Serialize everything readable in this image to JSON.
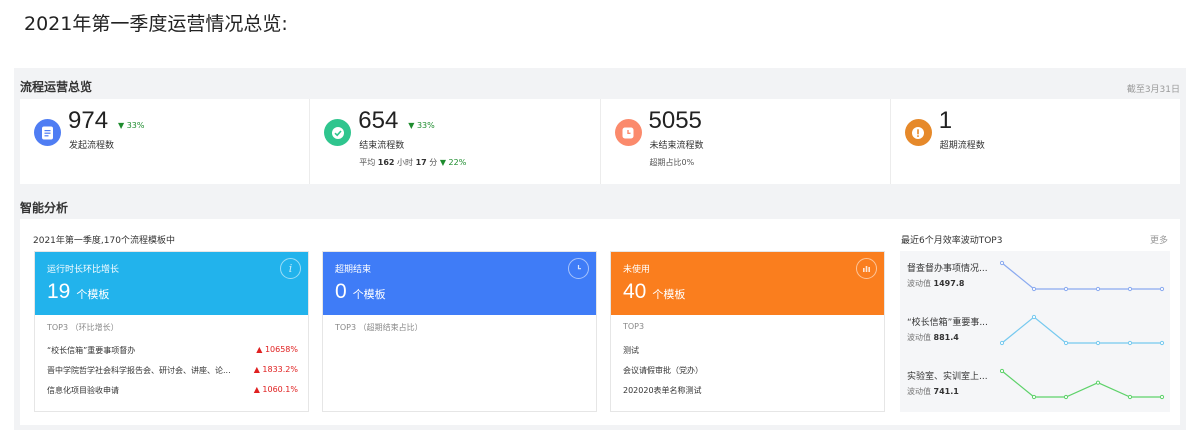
{
  "page_title": "2021年第一季度运营情况总览:",
  "overview": {
    "title": "流程运营总览",
    "date_note": "截至3月31日",
    "stats": [
      {
        "value": "974",
        "change": "▼ 33%",
        "label": "发起流程数",
        "color": "#4f7df3"
      },
      {
        "value": "654",
        "change": "▼ 33%",
        "label": "结束流程数",
        "sub": {
          "prefix": "平均",
          "hours": "162",
          "h_unit": "小时",
          "minutes": "17",
          "m_unit": "分",
          "change": "▼ 22%"
        },
        "color": "#2fc58e"
      },
      {
        "value": "5055",
        "label": "未结束流程数",
        "sub_text": "超期占比0%",
        "color": "#fb8a6c"
      },
      {
        "value": "1",
        "label": "超期流程数",
        "color": "#e6892a"
      }
    ]
  },
  "analysis": {
    "title": "智能分析",
    "subtitle": "2021年第一季度,170个流程模板中",
    "cards": [
      {
        "title": "运行时长环比增长",
        "value": "19",
        "unit": "个模板",
        "caption": "TOP3 （环比增长）",
        "rows": [
          {
            "name": "“校长信箱”重要事项督办",
            "pct": "▲ 10658%"
          },
          {
            "name": "晋中学院哲学社会科学报告会、研讨会、讲座、论...",
            "pct": "▲ 1833.2%"
          },
          {
            "name": "信息化项目验收申请",
            "pct": "▲ 1060.1%"
          }
        ]
      },
      {
        "title": "超期结束",
        "value": "0",
        "unit": "个模板",
        "caption": "TOP3 （超期结束占比）",
        "rows": []
      },
      {
        "title": "未使用",
        "value": "40",
        "unit": "个模板",
        "caption": "TOP3",
        "rows": [
          {
            "name": "测试",
            "pct": ""
          },
          {
            "name": "会议请假审批（党办）",
            "pct": ""
          },
          {
            "name": "202020表单名称测试",
            "pct": ""
          }
        ]
      }
    ],
    "top3": {
      "title": "最近6个月效率波动TOP3",
      "more": "更多",
      "wave_label": "波动值",
      "items": [
        {
          "name": "督查督办事项情况...",
          "value": "1497.8",
          "color": "#8aaaf0",
          "series": [
            1,
            0,
            0,
            0,
            0,
            0
          ]
        },
        {
          "name": "“校长信箱”重要事...",
          "value": "881.4",
          "color": "#76c9ef",
          "series": [
            0,
            1,
            0,
            0,
            0,
            0
          ]
        },
        {
          "name": "实验室、实训室上...",
          "value": "741.1",
          "color": "#5ed26a",
          "series": [
            1,
            0,
            0,
            0.55,
            0,
            0
          ]
        }
      ]
    }
  }
}
